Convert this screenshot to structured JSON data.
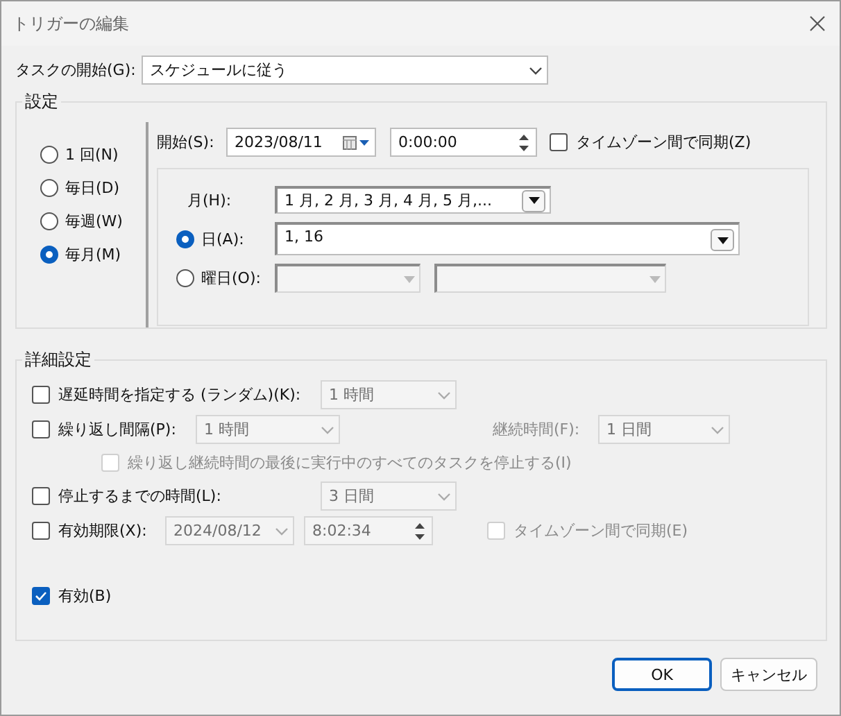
{
  "window": {
    "title": "トリガーの編集"
  },
  "task_start": {
    "label": "タスクの開始(G):",
    "value": "スケジュールに従う"
  },
  "settings": {
    "title": "設定",
    "frequency": [
      {
        "label": "1 回(N)",
        "selected": false
      },
      {
        "label": "毎日(D)",
        "selected": false
      },
      {
        "label": "毎週(W)",
        "selected": false
      },
      {
        "label": "毎月(M)",
        "selected": true
      }
    ],
    "start": {
      "label": "開始(S):",
      "date": "2023/08/11",
      "time": "0:00:00",
      "sync": {
        "label": "タイムゾーン間で同期(Z)",
        "checked": false
      }
    },
    "months": {
      "label": "月(H):",
      "value": "1 月, 2 月, 3 月, 4 月, 5 月,..."
    },
    "days": {
      "label": "日(A):",
      "selected": true,
      "value": "1, 16"
    },
    "weekdays": {
      "label": "曜日(O):",
      "selected": false
    }
  },
  "advanced": {
    "title": "詳細設定",
    "delay": {
      "label": "遅延時間を指定する (ランダム)(K):",
      "checked": false,
      "value": "1 時間"
    },
    "repeat": {
      "label": "繰り返し間隔(P):",
      "checked": false,
      "value": "1 時間",
      "duration_label": "継続時間(F):",
      "duration": "1 日間",
      "stop_all": {
        "label": "繰り返し継続時間の最後に実行中のすべてのタスクを停止する(I)",
        "checked": false
      }
    },
    "stop_after": {
      "label": "停止するまでの時間(L):",
      "checked": false,
      "value": "3 日間"
    },
    "expire": {
      "label": "有効期限(X):",
      "checked": false,
      "date": "2024/08/12",
      "time": "8:02:34",
      "sync": {
        "label": "タイムゾーン間で同期(E)",
        "checked": false
      }
    },
    "enabled": {
      "label": "有効(B)",
      "checked": true
    }
  },
  "buttons": [
    {
      "label": "OK",
      "default": true
    },
    {
      "label": "キャンセル",
      "default": false
    }
  ]
}
